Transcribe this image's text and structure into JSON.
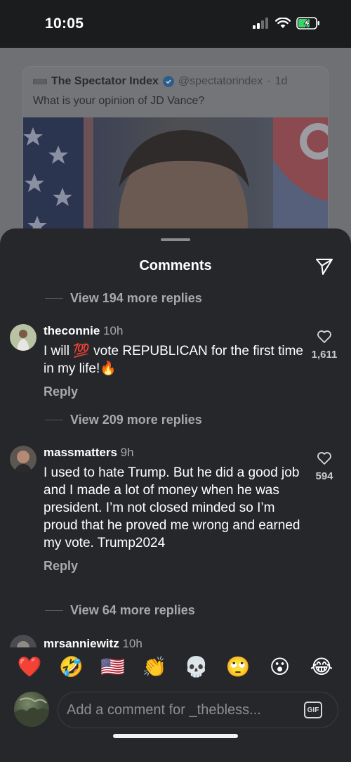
{
  "status_bar": {
    "time": "10:05"
  },
  "post": {
    "author": "The Spectator Index",
    "handle": "@spectatorindex",
    "age": "1d",
    "text": "What is your opinion of JD Vance?"
  },
  "sheet": {
    "title": "Comments",
    "view_replies": [
      "View 194 more replies",
      "View 209 more replies",
      "View 64 more replies"
    ],
    "comments": [
      {
        "username": "theconnie",
        "time": "10h",
        "text": "I will 💯 vote REPUBLICAN for the first time in my life!🔥",
        "reply_label": "Reply",
        "likes": "1,611"
      },
      {
        "username": "massmatters",
        "time": "9h",
        "text": "I used to hate Trump. But he did a good job and I made a lot of money when he was president. I’m not closed minded so I’m proud that he proved me wrong and earned my vote. Trump2024",
        "reply_label": "Reply",
        "likes": "594"
      },
      {
        "username": "mrsanniewitz",
        "time": "10h"
      }
    ]
  },
  "emoji_bar": [
    "❤️",
    "🤣",
    "🇺🇸",
    "👏",
    "💀",
    "🙄",
    "😮",
    "😂"
  ],
  "input": {
    "placeholder": "Add a comment for _thebless...",
    "gif_label": "GIF"
  }
}
